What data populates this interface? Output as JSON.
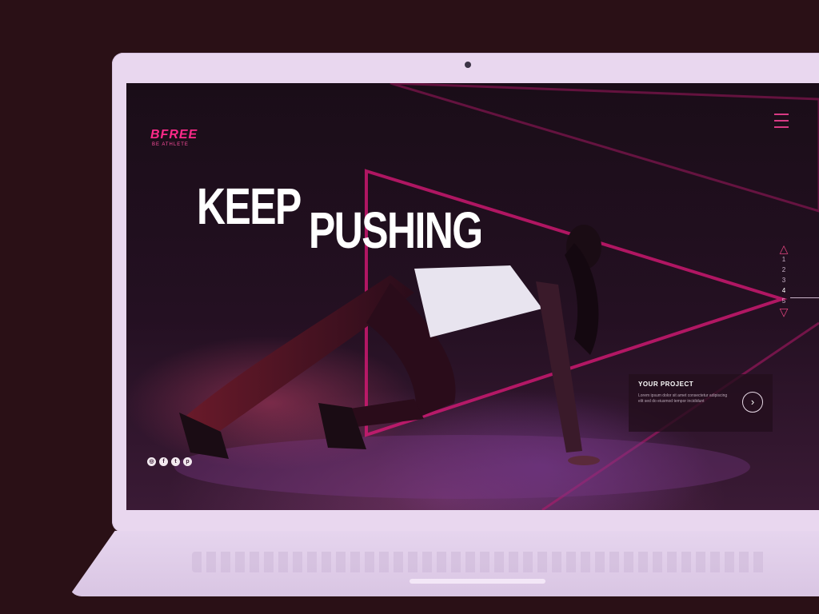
{
  "site": {
    "logo_text": "BFREE",
    "logo_sub": "BE ATHLETE"
  },
  "hero": {
    "headline_word_1": "KEEP",
    "headline_word_2": "PUSHING"
  },
  "menu": {
    "icon": "hamburger-menu-icon"
  },
  "pager": {
    "up_icon": "triangle-up-icon",
    "down_icon": "triangle-down-icon",
    "numbers": [
      "1",
      "2",
      "3",
      "4",
      "5"
    ],
    "active_index": 3
  },
  "project_card": {
    "title": "YOUR PROJECT",
    "body": "Lorem ipsum dolor sit amet consectetur adipiscing elit sed do eiusmod tempor incididunt",
    "arrow_icon": "arrow-right-circle-icon"
  },
  "socials": [
    {
      "icon": "instagram-icon",
      "glyph": "◎"
    },
    {
      "icon": "facebook-icon",
      "glyph": "f"
    },
    {
      "icon": "twitter-icon",
      "glyph": "t"
    },
    {
      "icon": "pinterest-icon",
      "glyph": "p"
    }
  ],
  "colors": {
    "accent": "#ff2a8a",
    "neon": "#e3447f",
    "frame": "#e9d7ef",
    "background": "#2a1016"
  }
}
